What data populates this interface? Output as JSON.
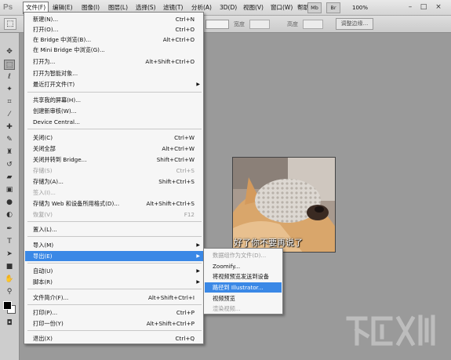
{
  "app": {
    "logo": "Ps"
  },
  "menubar": {
    "items": [
      "文件(F)",
      "编辑(E)",
      "图像(I)",
      "图层(L)",
      "选择(S)",
      "滤镜(T)",
      "分析(A)",
      "3D(D)",
      "视图(V)",
      "窗口(W)",
      "帮助(H)"
    ],
    "br_label": "Br",
    "mb_label": "Mb",
    "zoom": "100%",
    "window_controls": [
      "–",
      "□",
      "×"
    ]
  },
  "options": {
    "style_value": "",
    "width_label": "宽度",
    "height_label": "高度",
    "refine_edge_label": "调整边缘..."
  },
  "file_menu": {
    "items": [
      {
        "label": "新建(N)...",
        "shortcut": "Ctrl+N"
      },
      {
        "label": "打开(O)...",
        "shortcut": "Ctrl+O"
      },
      {
        "label": "在 Bridge 中浏览(B)...",
        "shortcut": "Alt+Ctrl+O"
      },
      {
        "label": "在 Mini Bridge 中浏览(G)...",
        "shortcut": ""
      },
      {
        "label": "打开为...",
        "shortcut": "Alt+Shift+Ctrl+O"
      },
      {
        "label": "打开为智能对象...",
        "shortcut": ""
      },
      {
        "label": "最近打开文件(T)",
        "shortcut": ""
      },
      {
        "label": "共享我的屏幕(H)...",
        "shortcut": ""
      },
      {
        "label": "创建新审核(W)...",
        "shortcut": ""
      },
      {
        "label": "Device Central...",
        "shortcut": ""
      },
      {
        "label": "关闭(C)",
        "shortcut": "Ctrl+W"
      },
      {
        "label": "关闭全部",
        "shortcut": "Alt+Ctrl+W"
      },
      {
        "label": "关闭并转到 Bridge...",
        "shortcut": "Shift+Ctrl+W"
      },
      {
        "label": "存储(S)",
        "shortcut": "Ctrl+S"
      },
      {
        "label": "存储为(A)...",
        "shortcut": "Shift+Ctrl+S"
      },
      {
        "label": "签入(I)...",
        "shortcut": ""
      },
      {
        "label": "存储为 Web 和设备所用格式(D)...",
        "shortcut": "Alt+Shift+Ctrl+S"
      },
      {
        "label": "恢复(V)",
        "shortcut": "F12"
      },
      {
        "label": "置入(L)...",
        "shortcut": ""
      },
      {
        "label": "导入(M)",
        "shortcut": ""
      },
      {
        "label": "导出(E)",
        "shortcut": ""
      },
      {
        "label": "自动(U)",
        "shortcut": ""
      },
      {
        "label": "脚本(R)",
        "shortcut": ""
      },
      {
        "label": "文件简介(F)...",
        "shortcut": "Alt+Shift+Ctrl+I"
      },
      {
        "label": "打印(P)...",
        "shortcut": "Ctrl+P"
      },
      {
        "label": "打印一份(Y)",
        "shortcut": "Alt+Shift+Ctrl+P"
      },
      {
        "label": "退出(X)",
        "shortcut": "Ctrl+Q"
      }
    ]
  },
  "export_submenu": {
    "items": [
      {
        "label": "数据组作为文件(D)..."
      },
      {
        "label": "Zoomify..."
      },
      {
        "label": "将视频预览发送到设备"
      },
      {
        "label": "路径到 Illustrator..."
      },
      {
        "label": "视频预览"
      },
      {
        "label": "渲染视频..."
      }
    ]
  },
  "canvas": {
    "caption": "好了你不要再说了"
  },
  "colors": {
    "highlight": "#3a88e6",
    "workspace": "#9a9a9a",
    "menu_bg": "#f6f6f6"
  }
}
